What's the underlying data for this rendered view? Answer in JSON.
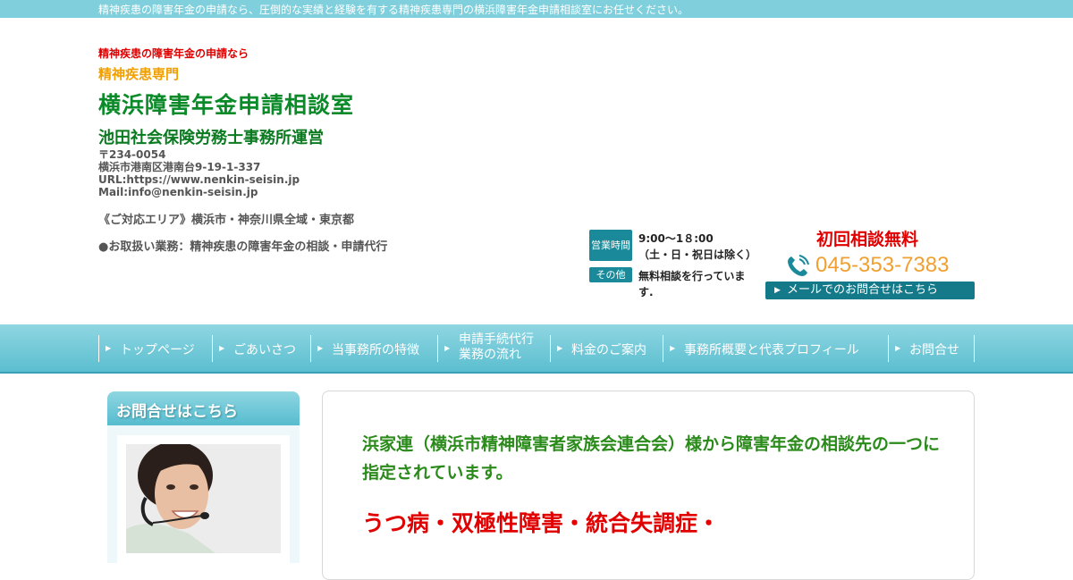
{
  "top_bar": {
    "text": "精神疾患の障害年金の申請なら、圧倒的な実績と経験を有する精神疾患専門の横浜障害年金申請相談室にお任せください。"
  },
  "header": {
    "tagline_red": "精神疾患の障害年金の申請なら",
    "tagline_orange": "精神疾患専門",
    "site_title": "横浜障害年金申請相談室",
    "site_subtitle": "池田社会保険労務士事務所運営",
    "address": {
      "postal": "〒234-0054",
      "street": "横浜市港南区港南台9-19-1-337",
      "url": "URL:https://www.nenkin-seisin.jp",
      "mail": "Mail:info@nenkin-seisin.jp"
    },
    "area": "《ご対応エリア》横浜市・神奈川県全域・東京都",
    "business": "●お取扱い業務：精神疾患の障害年金の相談・申請代行",
    "hours": {
      "badge_hours": "営業時間",
      "time": "9:00～1８:00",
      "note": "（土・日・祝日は除く）",
      "badge_other": "その他",
      "other_text": "無料相談を行っています."
    },
    "contact": {
      "free_consult": "初回相談無料",
      "phone": "045-353-7383",
      "phone_icon": "phone-icon",
      "mail_button": "メールでのお問合せはこちら"
    }
  },
  "nav": {
    "items": [
      {
        "label": "トップページ"
      },
      {
        "label": "ごあいさつ"
      },
      {
        "label": "当事務所の特徴"
      },
      {
        "label_line1": "申請手続代行",
        "label_line2": "業務の流れ"
      },
      {
        "label": "料金のご案内"
      },
      {
        "label": "事務所概要と代表プロフィール"
      },
      {
        "label": "お問合せ"
      }
    ]
  },
  "sidebar": {
    "heading": "お問合せはこちら",
    "photo": "operator-photo"
  },
  "main": {
    "paragraph1": "浜家連（横浜市精神障害者家族会連合会）様から障害年金の相談先の一つに指定されています。",
    "paragraph2": "うつ病・双極性障害・統合失調症・"
  },
  "colors": {
    "accent": "#5bbecf",
    "title_green": "#0a8a28",
    "alert_red": "#e00000",
    "phone_orange": "#f0a030",
    "badge_teal": "#1a8a9a"
  }
}
